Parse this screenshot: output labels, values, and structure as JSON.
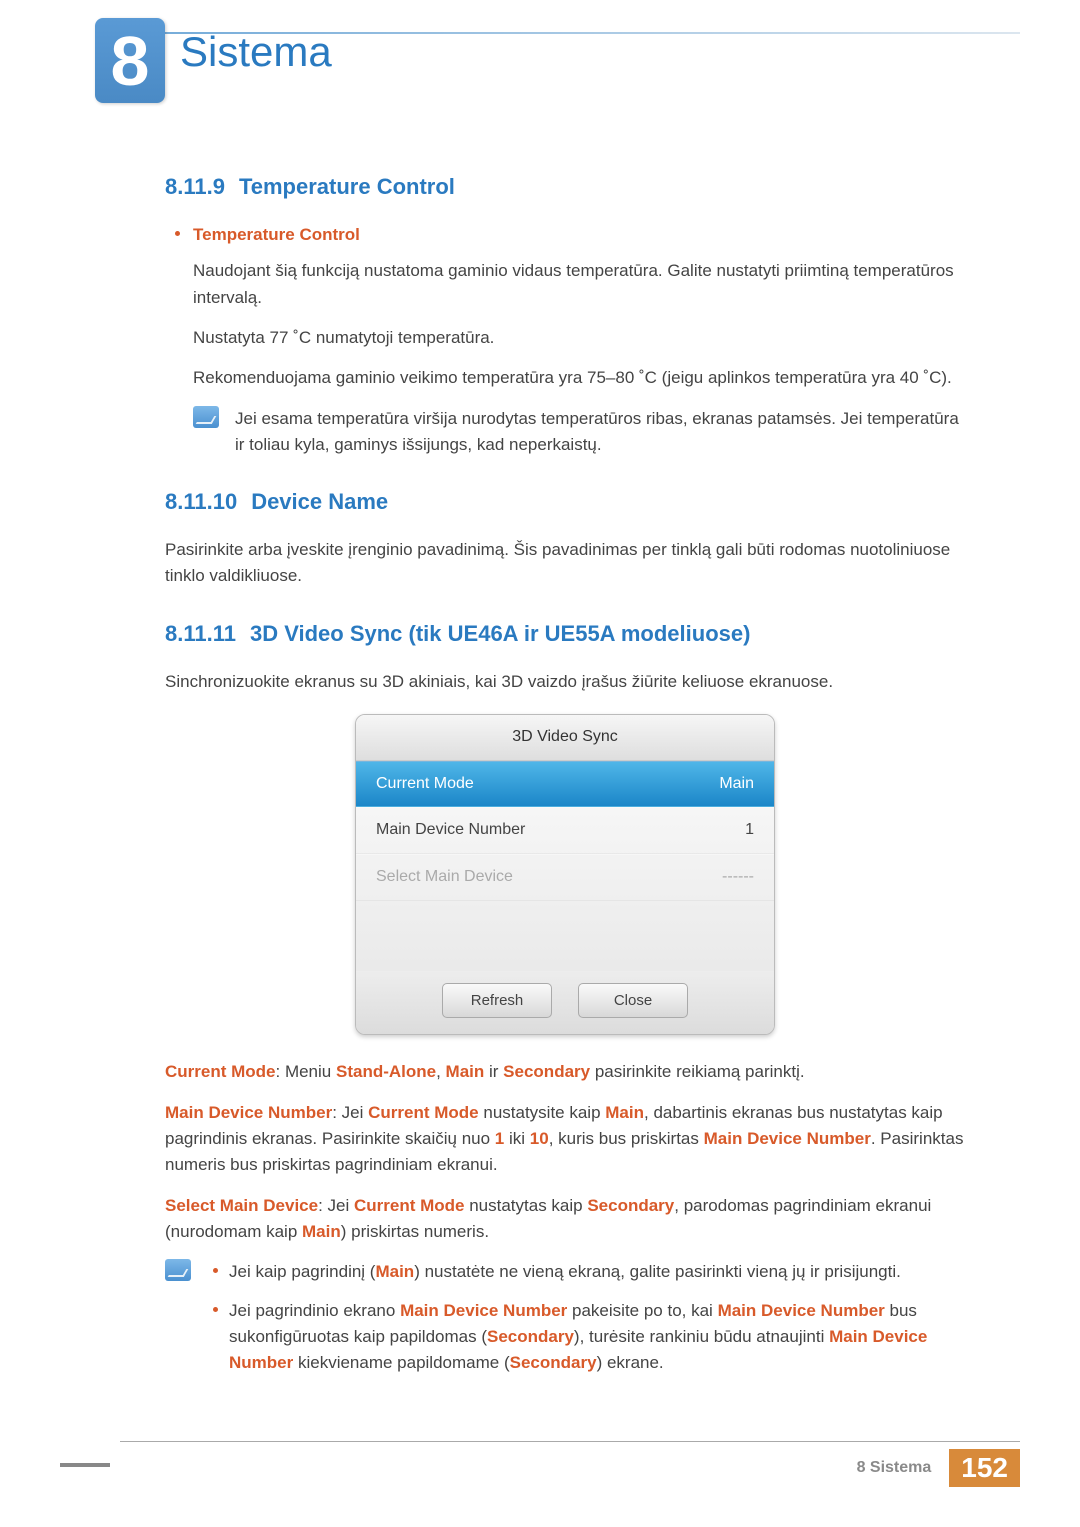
{
  "chapter": {
    "number": "8",
    "title": "Sistema"
  },
  "sections": {
    "s1": {
      "num": "8.11.9",
      "title": "Temperature Control",
      "bullet": "Temperature Control",
      "p1": "Naudojant šią funkciją nustatoma gaminio vidaus temperatūra. Galite nustatyti priimtiną temperatūros intervalą.",
      "p2": "Nustatyta 77 ˚C numatytoji temperatūra.",
      "p3": "Rekomenduojama gaminio veikimo temperatūra yra 75–80 ˚C (jeigu aplinkos temperatūra yra 40 ˚C).",
      "note": "Jei esama temperatūra viršija nurodytas temperatūros ribas, ekranas patamsės. Jei temperatūra ir toliau kyla, gaminys išsijungs, kad neperkaistų."
    },
    "s2": {
      "num": "8.11.10",
      "title": "Device Name",
      "p1": "Pasirinkite arba įveskite įrenginio pavadinimą. Šis pavadinimas per tinklą gali būti rodomas nuotoliniuose tinklo valdikliuose."
    },
    "s3": {
      "num": "8.11.11",
      "title": "3D Video Sync (tik UE46A ir UE55A modeliuose)",
      "p1": "Sinchronizuokite ekranus su 3D akiniais, kai 3D vaizdo įrašus žiūrite keliuose ekranuose."
    }
  },
  "osd": {
    "title": "3D Video Sync",
    "rows": [
      {
        "label": "Current Mode",
        "value": "Main",
        "state": "selected"
      },
      {
        "label": "Main Device Number",
        "value": "1",
        "state": "normal"
      },
      {
        "label": "Select Main Device",
        "value": "------",
        "state": "disabled"
      }
    ],
    "buttons": {
      "refresh": "Refresh",
      "close": "Close"
    }
  },
  "desc": {
    "cm_label": "Current Mode",
    "cm_pre": ": Meniu ",
    "cm_opt1": "Stand-Alone",
    "cm_mid1": ", ",
    "cm_opt2": "Main",
    "cm_mid2": " ir ",
    "cm_opt3": "Secondary",
    "cm_tail": " pasirinkite reikiamą parinktį.",
    "mdn_label": "Main Device Number",
    "mdn_pre": ": Jei ",
    "mdn_cm": "Current Mode",
    "mdn_mid1": " nustatysite kaip ",
    "mdn_main": "Main",
    "mdn_mid2": ", dabartinis ekranas bus nustatytas kaip pagrindinis ekranas. Pasirinkite skaičių nuo ",
    "mdn_one": "1",
    "mdn_mid3": " iki ",
    "mdn_ten": "10",
    "mdn_mid4": ", kuris bus priskirtas ",
    "mdn_mdn": "Main Device Number",
    "mdn_tail": ". Pasirinktas numeris bus priskirtas pagrindiniam ekranui.",
    "smd_label": "Select Main Device",
    "smd_pre": ": Jei ",
    "smd_cm": "Current Mode",
    "smd_mid1": " nustatytas kaip ",
    "smd_sec": "Secondary",
    "smd_mid2": ", parodomas pagrindiniam ekranui (nurodomam kaip ",
    "smd_main": "Main",
    "smd_tail": ") priskirtas numeris.",
    "note1_a": "Jei kaip pagrindinį (",
    "note1_main": "Main",
    "note1_b": ") nustatėte ne vieną ekraną, galite pasirinkti vieną jų ir prisijungti.",
    "note2_a": "Jei pagrindinio ekrano ",
    "note2_mdn1": "Main Device Number",
    "note2_b": " pakeisite po to, kai ",
    "note2_mdn2": "Main Device Number",
    "note2_c": " bus sukonfigūruotas kaip papildomas (",
    "note2_sec1": "Secondary",
    "note2_d": "), turėsite rankiniu būdu atnaujinti ",
    "note2_mdn3": "Main Device Number",
    "note2_e": " kiekviename papildomame (",
    "note2_sec2": "Secondary",
    "note2_f": ") ekrane."
  },
  "footer": {
    "breadcrumb": "8 Sistema",
    "page": "152"
  }
}
